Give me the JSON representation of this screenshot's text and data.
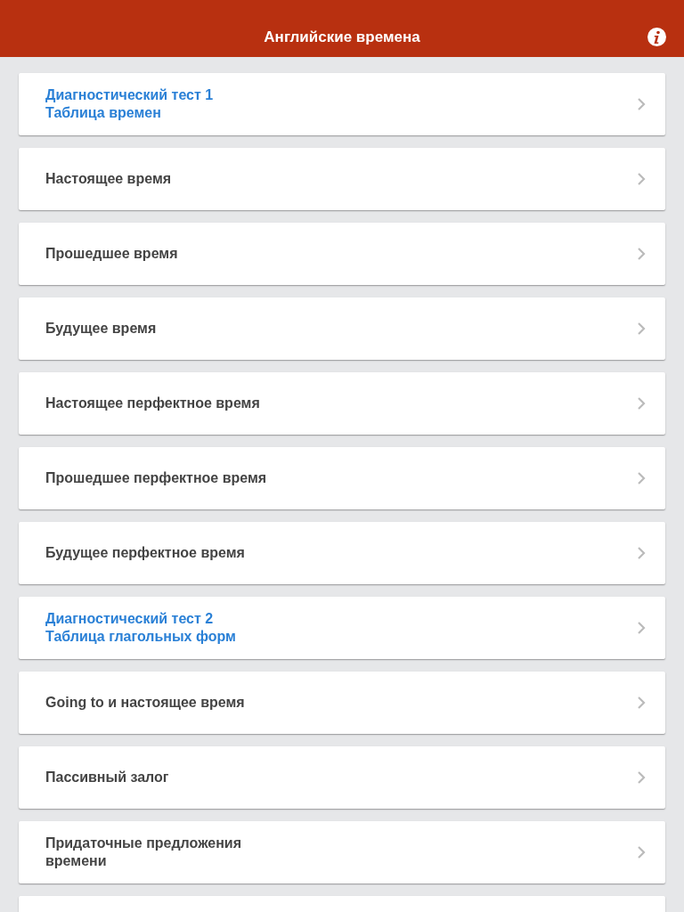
{
  "header": {
    "title": "Английские времена"
  },
  "items": [
    {
      "kind": "test",
      "title": "Диагностический тест 1",
      "subtitle": "Таблица времен"
    },
    {
      "kind": "topic",
      "title": "Настоящее время"
    },
    {
      "kind": "topic",
      "title": "Прошедшее время"
    },
    {
      "kind": "topic",
      "title": "Будущее время"
    },
    {
      "kind": "topic",
      "title": "Настоящее перфектное время"
    },
    {
      "kind": "topic",
      "title": "Прошедшее перфектное время"
    },
    {
      "kind": "topic",
      "title": "Будущее перфектное время"
    },
    {
      "kind": "test",
      "title": "Диагностический тест 2",
      "subtitle": "Таблица глагольных форм"
    },
    {
      "kind": "topic",
      "title": "Going to и настоящее время"
    },
    {
      "kind": "topic",
      "title": "Пассивный залог"
    },
    {
      "kind": "topic",
      "title": "Придаточные предложения времени"
    }
  ]
}
